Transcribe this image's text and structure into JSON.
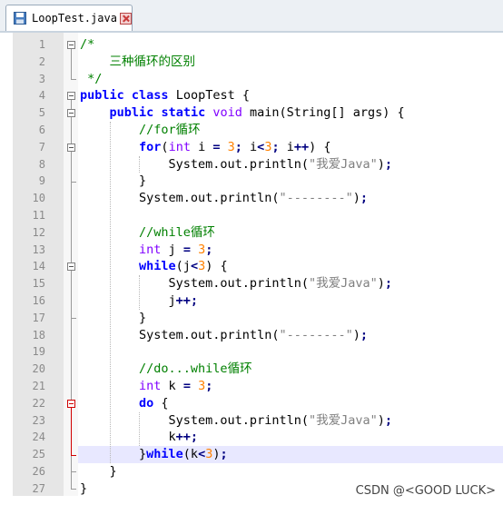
{
  "tab": {
    "label": "LoopTest.java"
  },
  "watermark": "CSDN @<GOOD LUCK>",
  "current_line": 25,
  "lines": [
    {
      "n": "1",
      "t": [
        [
          "cmt",
          "/*"
        ]
      ]
    },
    {
      "n": "2",
      "t": [
        [
          "cmt",
          "    三种循环的区别"
        ]
      ]
    },
    {
      "n": "3",
      "t": [
        [
          "cmt",
          " */"
        ]
      ]
    },
    {
      "n": "4",
      "t": [
        [
          "kw",
          "public"
        ],
        [
          "plain",
          " "
        ],
        [
          "kw",
          "class"
        ],
        [
          "plain",
          " LoopTest {"
        ]
      ]
    },
    {
      "n": "5",
      "t": [
        [
          "plain",
          "    "
        ],
        [
          "kw",
          "public"
        ],
        [
          "plain",
          " "
        ],
        [
          "kw",
          "static"
        ],
        [
          "plain",
          " "
        ],
        [
          "ty",
          "void"
        ],
        [
          "plain",
          " main(String[] args) {"
        ]
      ]
    },
    {
      "n": "6",
      "t": [
        [
          "plain",
          "        "
        ],
        [
          "cmt",
          "//for循环"
        ]
      ]
    },
    {
      "n": "7",
      "t": [
        [
          "plain",
          "        "
        ],
        [
          "kw",
          "for"
        ],
        [
          "plain",
          "("
        ],
        [
          "ty",
          "int"
        ],
        [
          "plain",
          " i "
        ],
        [
          "op",
          "="
        ],
        [
          "plain",
          " "
        ],
        [
          "num",
          "3"
        ],
        [
          "op",
          ";"
        ],
        [
          "plain",
          " i"
        ],
        [
          "op",
          "<"
        ],
        [
          "num",
          "3"
        ],
        [
          "op",
          ";"
        ],
        [
          "plain",
          " i"
        ],
        [
          "op",
          "++"
        ],
        [
          "plain",
          ") {"
        ]
      ]
    },
    {
      "n": "8",
      "t": [
        [
          "plain",
          "            System.out.println("
        ],
        [
          "str",
          "\"我爱Java\""
        ],
        [
          "plain",
          ")"
        ],
        [
          "op",
          ";"
        ]
      ]
    },
    {
      "n": "9",
      "t": [
        [
          "plain",
          "        }"
        ]
      ]
    },
    {
      "n": "10",
      "t": [
        [
          "plain",
          "        System.out.println("
        ],
        [
          "str",
          "\"--------\""
        ],
        [
          "plain",
          ")"
        ],
        [
          "op",
          ";"
        ]
      ]
    },
    {
      "n": "11",
      "t": []
    },
    {
      "n": "12",
      "t": [
        [
          "plain",
          "        "
        ],
        [
          "cmt",
          "//while循环"
        ]
      ]
    },
    {
      "n": "13",
      "t": [
        [
          "plain",
          "        "
        ],
        [
          "ty",
          "int"
        ],
        [
          "plain",
          " j "
        ],
        [
          "op",
          "="
        ],
        [
          "plain",
          " "
        ],
        [
          "num",
          "3"
        ],
        [
          "op",
          ";"
        ]
      ]
    },
    {
      "n": "14",
      "t": [
        [
          "plain",
          "        "
        ],
        [
          "kw",
          "while"
        ],
        [
          "plain",
          "(j"
        ],
        [
          "op",
          "<"
        ],
        [
          "num",
          "3"
        ],
        [
          "plain",
          ") {"
        ]
      ]
    },
    {
      "n": "15",
      "t": [
        [
          "plain",
          "            System.out.println("
        ],
        [
          "str",
          "\"我爱Java\""
        ],
        [
          "plain",
          ")"
        ],
        [
          "op",
          ";"
        ]
      ]
    },
    {
      "n": "16",
      "t": [
        [
          "plain",
          "            j"
        ],
        [
          "op",
          "++;"
        ]
      ]
    },
    {
      "n": "17",
      "t": [
        [
          "plain",
          "        }"
        ]
      ]
    },
    {
      "n": "18",
      "t": [
        [
          "plain",
          "        System.out.println("
        ],
        [
          "str",
          "\"--------\""
        ],
        [
          "plain",
          ")"
        ],
        [
          "op",
          ";"
        ]
      ]
    },
    {
      "n": "19",
      "t": []
    },
    {
      "n": "20",
      "t": [
        [
          "plain",
          "        "
        ],
        [
          "cmt",
          "//do...while循环"
        ]
      ]
    },
    {
      "n": "21",
      "t": [
        [
          "plain",
          "        "
        ],
        [
          "ty",
          "int"
        ],
        [
          "plain",
          " k "
        ],
        [
          "op",
          "="
        ],
        [
          "plain",
          " "
        ],
        [
          "num",
          "3"
        ],
        [
          "op",
          ";"
        ]
      ]
    },
    {
      "n": "22",
      "t": [
        [
          "plain",
          "        "
        ],
        [
          "kw",
          "do"
        ],
        [
          "plain",
          " {"
        ]
      ]
    },
    {
      "n": "23",
      "t": [
        [
          "plain",
          "            System.out.println("
        ],
        [
          "str",
          "\"我爱Java\""
        ],
        [
          "plain",
          ")"
        ],
        [
          "op",
          ";"
        ]
      ]
    },
    {
      "n": "24",
      "t": [
        [
          "plain",
          "            k"
        ],
        [
          "op",
          "++;"
        ]
      ]
    },
    {
      "n": "25",
      "t": [
        [
          "plain",
          "        }"
        ],
        [
          "kw",
          "while"
        ],
        [
          "plain",
          "(k"
        ],
        [
          "op",
          "<"
        ],
        [
          "num",
          "3"
        ],
        [
          "plain",
          ")"
        ],
        [
          "op",
          ";"
        ]
      ]
    },
    {
      "n": "26",
      "t": [
        [
          "plain",
          "    }"
        ]
      ]
    },
    {
      "n": "27",
      "t": [
        [
          "plain",
          "}"
        ]
      ]
    }
  ]
}
